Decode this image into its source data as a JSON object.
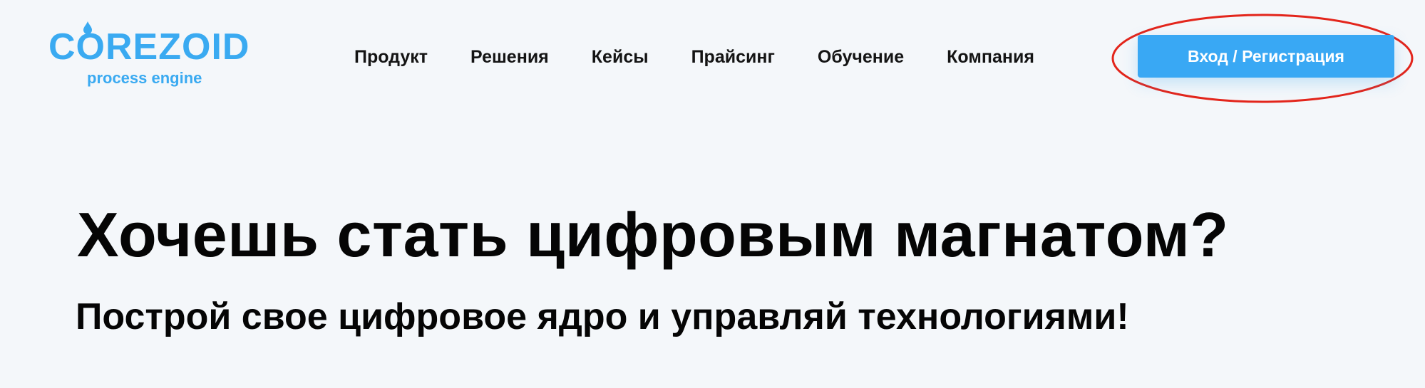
{
  "brand": {
    "name": "COREZOID",
    "tagline": "process engine",
    "color": "#3aaaf1"
  },
  "nav": {
    "items": [
      {
        "label": "Продукт"
      },
      {
        "label": "Решения"
      },
      {
        "label": "Кейсы"
      },
      {
        "label": "Прайсинг"
      },
      {
        "label": "Обучение"
      },
      {
        "label": "Компания"
      }
    ]
  },
  "auth": {
    "button_label": "Вход / Регистрация",
    "button_color": "#39a8f4",
    "highlight_color": "#e3251b"
  },
  "hero": {
    "title": "Хочешь стать цифровым магнатом?",
    "subtitle": "Построй свое цифровое ядро и управляй технологиями!"
  },
  "icons": {
    "logo_drop": "water-drop-icon"
  },
  "colors": {
    "background": "#f4f7fa",
    "text": "#111111"
  }
}
